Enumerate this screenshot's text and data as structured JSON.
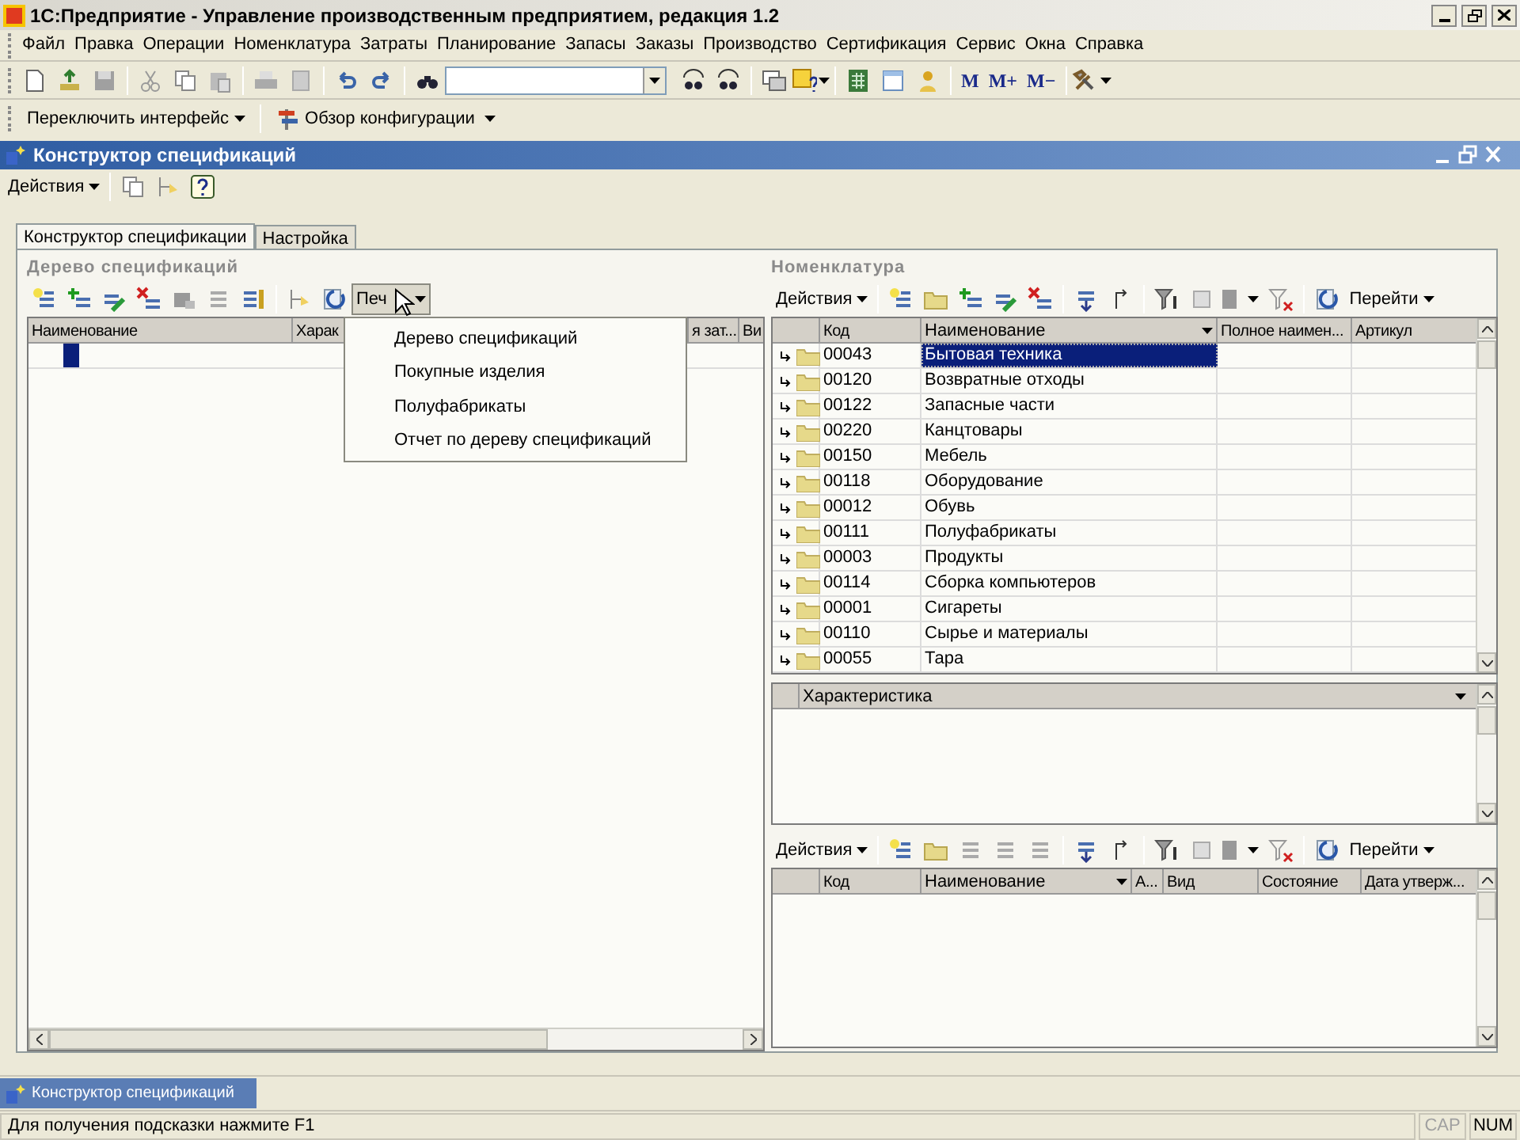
{
  "window": {
    "title": "1С:Предприятие - Управление производственным предприятием, редакция 1.2"
  },
  "menu": [
    "Файл",
    "Правка",
    "Операции",
    "Номенклатура",
    "Затраты",
    "Планирование",
    "Запасы",
    "Заказы",
    "Производство",
    "Сертификация",
    "Сервис",
    "Окна",
    "Справка"
  ],
  "toolbar": {
    "memory_buttons": [
      "M",
      "M+",
      "M−"
    ]
  },
  "toolbar2": {
    "buttons": [
      "Переключить интерфейс",
      "Обзор конфигурации"
    ]
  },
  "form": {
    "title": "Конструктор спецификаций",
    "actions": "Действия",
    "tabs": [
      {
        "label": "Конструктор спецификации",
        "selected": true
      },
      {
        "label": "Настройка",
        "selected": false
      }
    ],
    "tree": {
      "title": "Дерево спецификаций",
      "print_button": "Печ",
      "columns": [
        "Наименование",
        "Харак",
        "я зат...",
        "Ви"
      ]
    },
    "print_menu": [
      "Дерево спецификаций",
      "Покупные изделия",
      "Полуфабрикаты",
      "Отчет по дереву спецификаций"
    ],
    "nomenclature": {
      "title": "Номенклатура",
      "actions": "Действия",
      "goto": "Перейти",
      "columns": [
        "Код",
        "Наименование",
        "Полное наимен...",
        "Артикул"
      ],
      "rows": [
        {
          "code": "00043",
          "name": "Бытовая техника",
          "selected": true
        },
        {
          "code": "00120",
          "name": "Возвратные отходы",
          "selected": false
        },
        {
          "code": "00122",
          "name": "Запасные части",
          "selected": false
        },
        {
          "code": "00220",
          "name": "Канцтовары",
          "selected": false
        },
        {
          "code": "00150",
          "name": "Мебель",
          "selected": false
        },
        {
          "code": "00118",
          "name": "Оборудование",
          "selected": false
        },
        {
          "code": "00012",
          "name": "Обувь",
          "selected": false
        },
        {
          "code": "00111",
          "name": "Полуфабрикаты",
          "selected": false
        },
        {
          "code": "00003",
          "name": "Продукты",
          "selected": false
        },
        {
          "code": "00114",
          "name": "Сборка компьютеров",
          "selected": false
        },
        {
          "code": "00001",
          "name": "Сигареты",
          "selected": false
        },
        {
          "code": "00110",
          "name": "Сырье и материалы",
          "selected": false
        },
        {
          "code": "00055",
          "name": "Тара",
          "selected": false
        }
      ]
    },
    "characteristics": {
      "columns": [
        "Характеристика"
      ]
    },
    "specifications": {
      "actions": "Действия",
      "goto": "Перейти",
      "columns": [
        "Код",
        "Наименование",
        "А...",
        "Вид",
        "Состояние",
        "Дата утверж..."
      ]
    }
  },
  "taskbar": [
    {
      "label": "Конструктор спецификаций",
      "selected": true
    }
  ],
  "status_bar": {
    "hint": "Для получения подсказки нажмите F1",
    "indicators": [
      {
        "label": "CAP",
        "on": false
      },
      {
        "label": "NUM",
        "on": true
      }
    ]
  }
}
